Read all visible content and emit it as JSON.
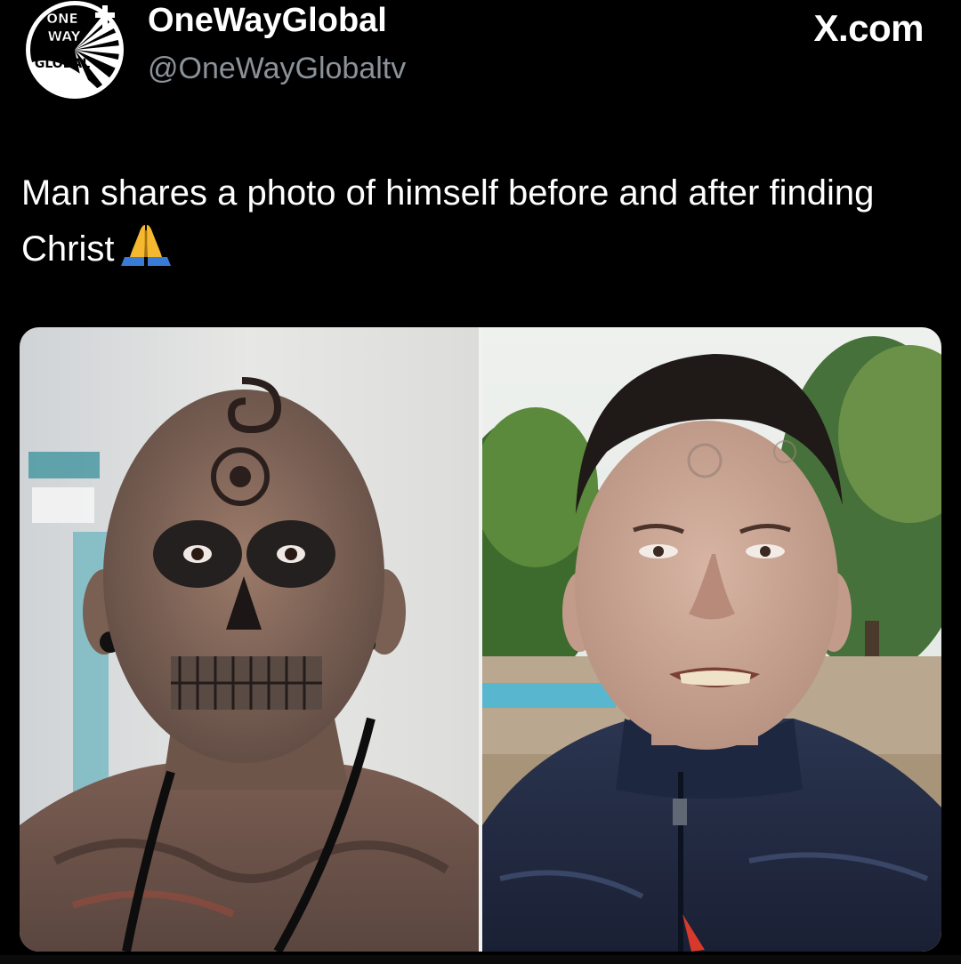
{
  "author": {
    "name": "OneWayGlobal",
    "handle": "@OneWayGlobaltv",
    "avatar_logo_lines": [
      "ONE",
      "WAY",
      "GLOBAL"
    ],
    "avatar_icon": "cross-sunburst-logo"
  },
  "source_label": "X.com",
  "post": {
    "text": "Man shares a photo of himself before and after finding Christ",
    "emoji_icon": "folded-hands-icon"
  },
  "media": {
    "layout": "side-by-side",
    "images": [
      {
        "role": "before",
        "subject": "tattooed-man-photo"
      },
      {
        "role": "after",
        "subject": "man-in-jacket-photo"
      }
    ]
  },
  "colors": {
    "background": "#000000",
    "text_primary": "#ffffff",
    "text_secondary": "#8b9299",
    "emoji_hands": "#f5b82e",
    "emoji_sleeve": "#3a7bd5"
  }
}
